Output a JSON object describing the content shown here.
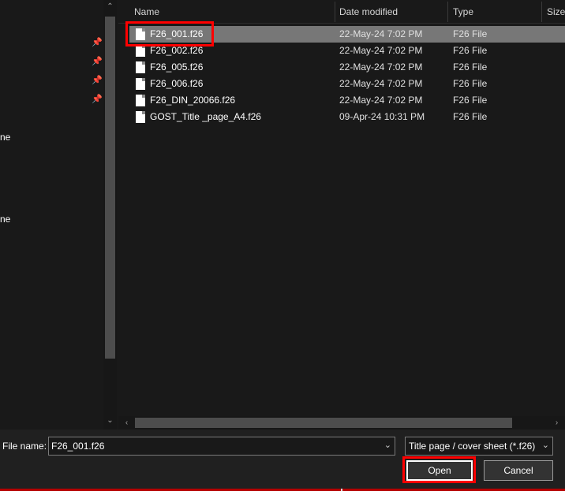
{
  "nav": {
    "labels": [
      "ne",
      "ne"
    ],
    "pins": [
      "pin-icon",
      "pin-icon",
      "pin-icon",
      "pin-icon"
    ]
  },
  "columns": {
    "name": "Name",
    "date": "Date modified",
    "type": "Type",
    "size": "Size"
  },
  "files": [
    {
      "name": "F26_001.f26",
      "date": "22-May-24 7:02 PM",
      "type": "F26 File",
      "selected": true
    },
    {
      "name": "F26_002.f26",
      "date": "22-May-24 7:02 PM",
      "type": "F26 File"
    },
    {
      "name": "F26_005.f26",
      "date": "22-May-24 7:02 PM",
      "type": "F26 File"
    },
    {
      "name": "F26_006.f26",
      "date": "22-May-24 7:02 PM",
      "type": "F26 File"
    },
    {
      "name": "F26_DIN_20066.f26",
      "date": "22-May-24 7:02 PM",
      "type": "F26 File"
    },
    {
      "name": "GOST_Title _page_A4.f26",
      "date": "09-Apr-24 10:31 PM",
      "type": "F26 File"
    }
  ],
  "footer": {
    "filename_label": "File name:",
    "filename_value": "F26_001.f26",
    "filter_value": "Title page / cover sheet (*.f26)",
    "open_label": "Open",
    "cancel_label": "Cancel"
  },
  "colors": {
    "highlight": "#ff0000",
    "selected_row": "#777777",
    "background": "#191919"
  }
}
